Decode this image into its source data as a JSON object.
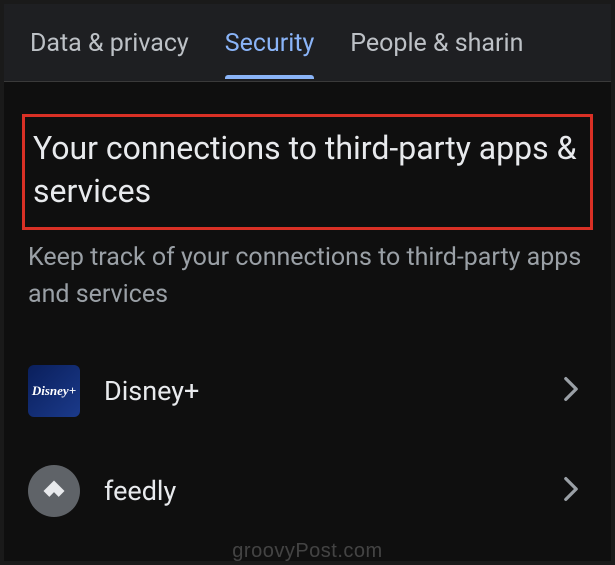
{
  "tabs": {
    "data_privacy": "Data & privacy",
    "security": "Security",
    "people_sharing": "People & sharin"
  },
  "section": {
    "title": "Your connections to third-party apps & services",
    "description": "Keep track of your connections to third-party apps and services"
  },
  "apps": [
    {
      "name": "Disney+",
      "icon": "disney-plus-icon"
    },
    {
      "name": "feedly",
      "icon": "feedly-icon"
    }
  ],
  "watermark": "groovyPost.com",
  "colors": {
    "accent": "#8ab4f8",
    "highlight_border": "#d93025",
    "background": "#0f0f0f"
  }
}
